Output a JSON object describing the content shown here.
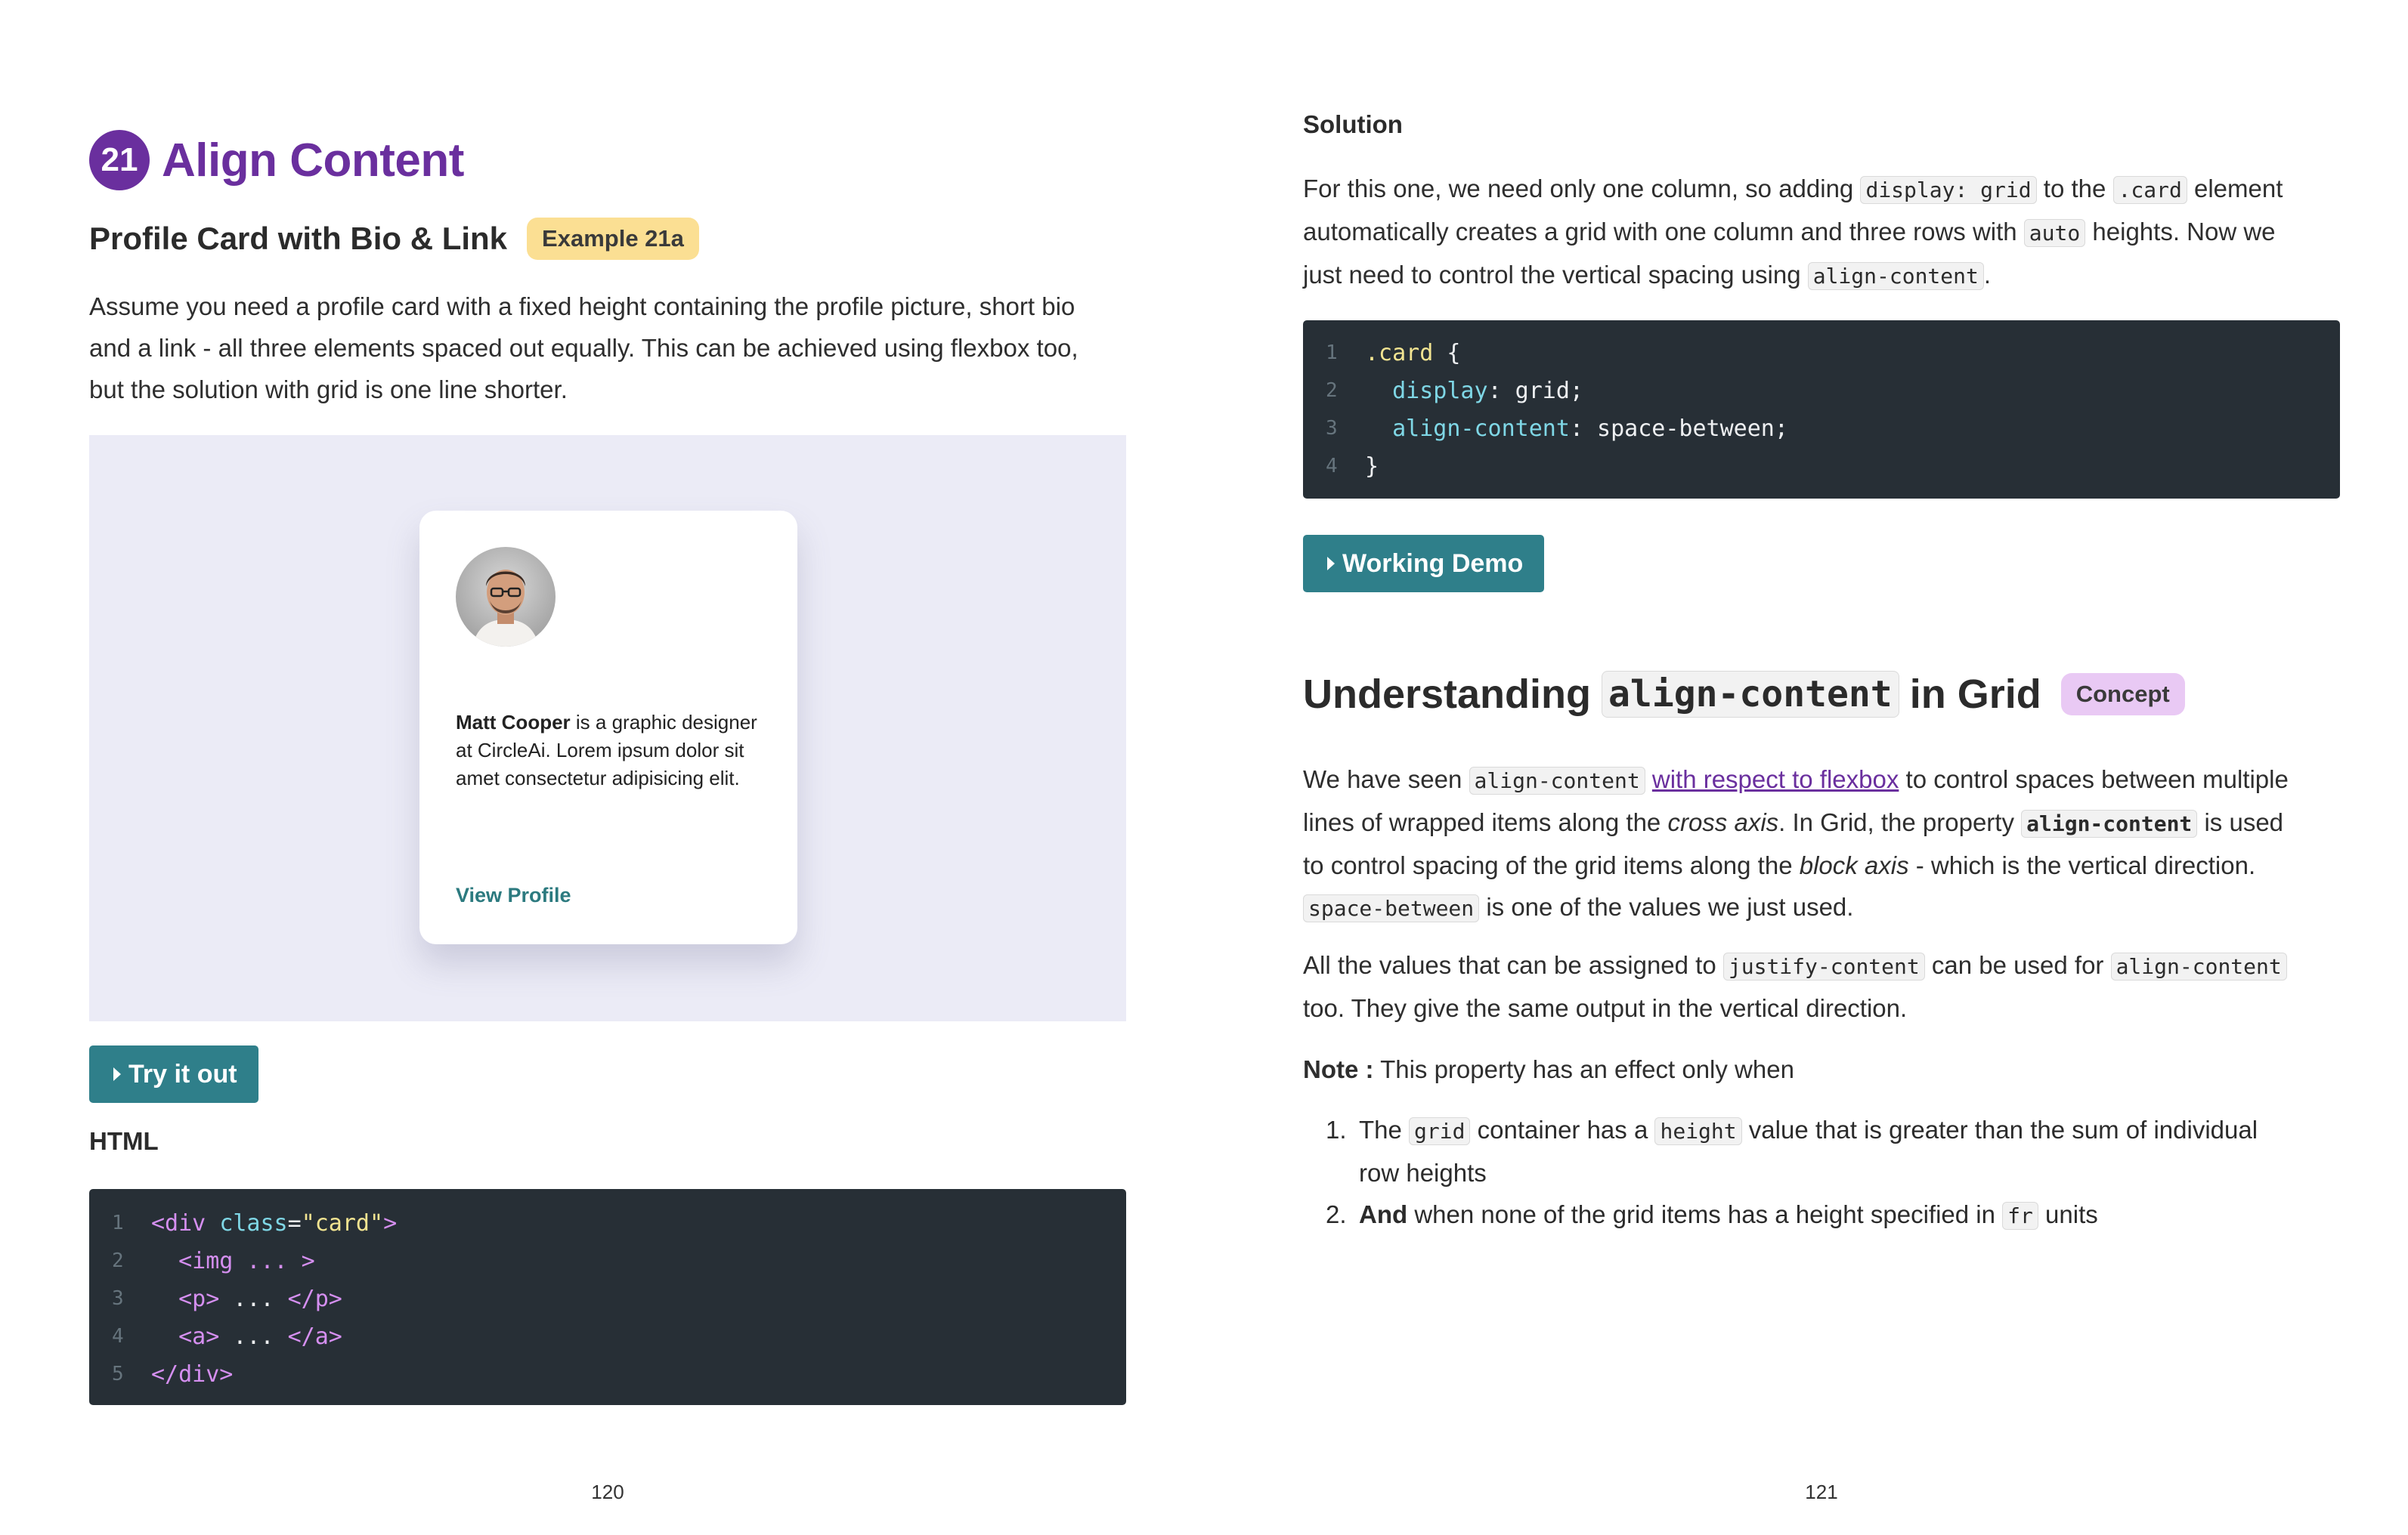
{
  "left_page": {
    "chapter_number": "21",
    "chapter_title": "Align Content",
    "subtitle": "Profile Card with Bio & Link",
    "example_badge": "Example 21a",
    "intro_p1": "Assume you need a profile card with a fixed height containing the profile picture, short bio",
    "intro_p2": "and a link - all three elements spaced out equally. This can be achieved using flexbox too,",
    "intro_p3": "but the solution with grid is one line shorter.",
    "card": {
      "name": "Matt Cooper",
      "bio_rest": " is a graphic designer at CircleAi. Lorem ipsum dolor sit amet consectetur adipisicing elit.",
      "link_label": "View Profile"
    },
    "try_button": "Try it out",
    "html_label": "HTML",
    "html_code": {
      "line_numbers": [
        "1",
        "2",
        "3",
        "4",
        "5"
      ],
      "l1_open": "<div ",
      "l1_attr": "class",
      "l1_eq": "=",
      "l1_str": "\"card\"",
      "l1_close": ">",
      "l2": "<img ... >",
      "l3_open": "<p>",
      "l3_mid": " ... ",
      "l3_close": "</p>",
      "l4_open": "<a>",
      "l4_mid": " ... ",
      "l4_close": "</a>",
      "l5": "</div>"
    },
    "page_number": "120"
  },
  "right_page": {
    "solution_label": "Solution",
    "solution_text": {
      "t1": "For this one, we need only one column, so adding ",
      "c1": "display: grid",
      "t2": " to the ",
      "c2": ".card",
      "t3": " element",
      "t4": "automatically creates a grid with one column and three rows with ",
      "c3": "auto",
      "t5": " heights. Now we",
      "t6": "just need to control the vertical spacing using ",
      "c4": "align-content",
      "t7": "."
    },
    "css_code": {
      "line_numbers": [
        "1",
        "2",
        "3",
        "4"
      ],
      "l1_sel": ".card",
      "l1_brace": " {",
      "l2_prop": "display",
      "l2_val": ": grid;",
      "l3_prop": "align-content",
      "l3_val": ": space-between;",
      "l4": "}"
    },
    "demo_button": "Working Demo",
    "heading": {
      "pre": "Understanding",
      "code": "align-content",
      "post": "in Grid",
      "badge": "Concept"
    },
    "para1": {
      "t1": "We have seen ",
      "c1": "align-content",
      "link": "with respect to flexbox",
      "t2": " to control spaces between multiple",
      "t3": "lines of wrapped items along the ",
      "em1": "cross axis",
      "t4": ". In Grid, the property ",
      "c2": "align-content",
      "t5": " is used",
      "t6": "to control spacing of the grid items along the ",
      "em2": "block axis",
      "t7": " - which is the vertical direction.",
      "c3": "space-between",
      "t8": " is one of the values we just used."
    },
    "para2": {
      "t1": "All the values that can be assigned to ",
      "c1": "justify-content",
      "t2": " can be used for ",
      "c2": "align-content",
      "t3": "too. They give the same output in the vertical direction."
    },
    "note": {
      "label": "Note :",
      "text": " This property has an effect only when"
    },
    "list": [
      {
        "num": "1.",
        "t1": "The ",
        "c1": "grid",
        "t2": " container has a ",
        "c2": "height",
        "t3": " value that is greater than the sum of individual",
        "t4": "row heights"
      },
      {
        "num": "2.",
        "b1": "And",
        "t1": " when none of the grid items has a height specified in ",
        "c1": "fr",
        "t2": " units"
      }
    ],
    "page_number": "121"
  },
  "colors": {
    "accent_purple": "#6a2f9e",
    "button_teal": "#2f7f8a",
    "code_bg": "#272f36",
    "preview_bg": "#ebebf6"
  }
}
